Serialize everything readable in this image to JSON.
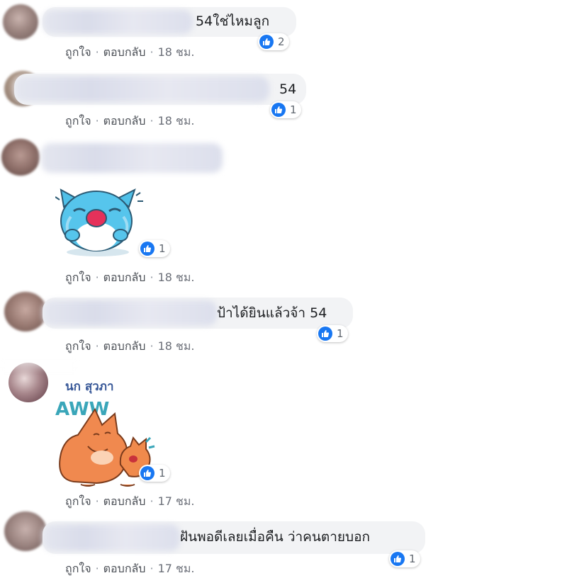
{
  "labels": {
    "like": "ถูกใจ",
    "reply": "ตอบกลับ",
    "dot": "·"
  },
  "comments": [
    {
      "text": "54ใช่ไหมลูก",
      "time": "18 ชม.",
      "likes": "2"
    },
    {
      "text": "54",
      "time": "18 ชม.",
      "likes": "1"
    },
    {
      "time": "18 ชม.",
      "likes": "1",
      "sticker": "crying-cat-sticker"
    },
    {
      "text": "ป้าได้ยินแล้วจ้า 54",
      "time": "18 ชม.",
      "likes": "1"
    },
    {
      "author": "นก สุวภา",
      "sticker_text": "AWW",
      "time": "17 ชม.",
      "likes": "1",
      "sticker": "aww-cat-sticker"
    },
    {
      "text": "ฝันพอดีเลยเมื่อคืน ว่าคนตายบอก",
      "time": "17 ชม.",
      "likes": "1"
    }
  ],
  "colors": {
    "like_blue": "#1877f2",
    "bubble": "#f2f3f5",
    "author": "#385898",
    "meta": "#6b6f78"
  }
}
